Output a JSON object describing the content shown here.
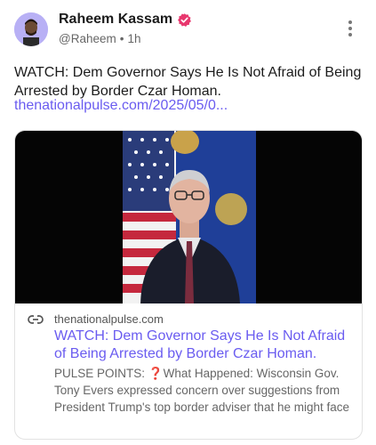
{
  "post": {
    "author_name": "Raheem Kassam",
    "author_handle": "@Raheem",
    "separator": "•",
    "time": "1h",
    "text": "WATCH: Dem Governor Says He Is Not Afraid of Being Arrested by Border Czar Homan.",
    "link": "thenationalpulse.com/2025/05/0..."
  },
  "link_card": {
    "domain": "thenationalpulse.com",
    "title": "WATCH: Dem Governor Says He Is Not Afraid of Being Arrested by Border Czar Homan.",
    "description": "PULSE POINTS: ❓What Happened: Wisconsin Gov. Tony Evers expressed concern over suggestions from President Trump's top border adviser that he might face"
  },
  "icons": {
    "verified": "verified-badge-icon",
    "more": "more-vertical-icon",
    "link": "link-icon"
  },
  "colors": {
    "accent": "#6a5cf0",
    "verified": "#e8376e"
  }
}
